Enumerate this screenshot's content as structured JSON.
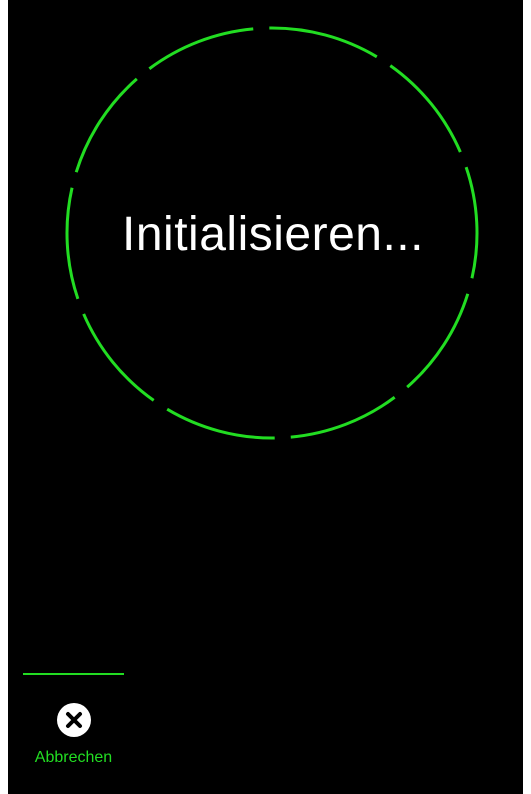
{
  "status": {
    "text": "Initialisieren..."
  },
  "actions": {
    "cancel_label": "Abbrechen",
    "cancel_icon": "close-circle-icon"
  },
  "colors": {
    "background": "#000000",
    "accent": "#22dd22",
    "text": "#ffffff"
  }
}
